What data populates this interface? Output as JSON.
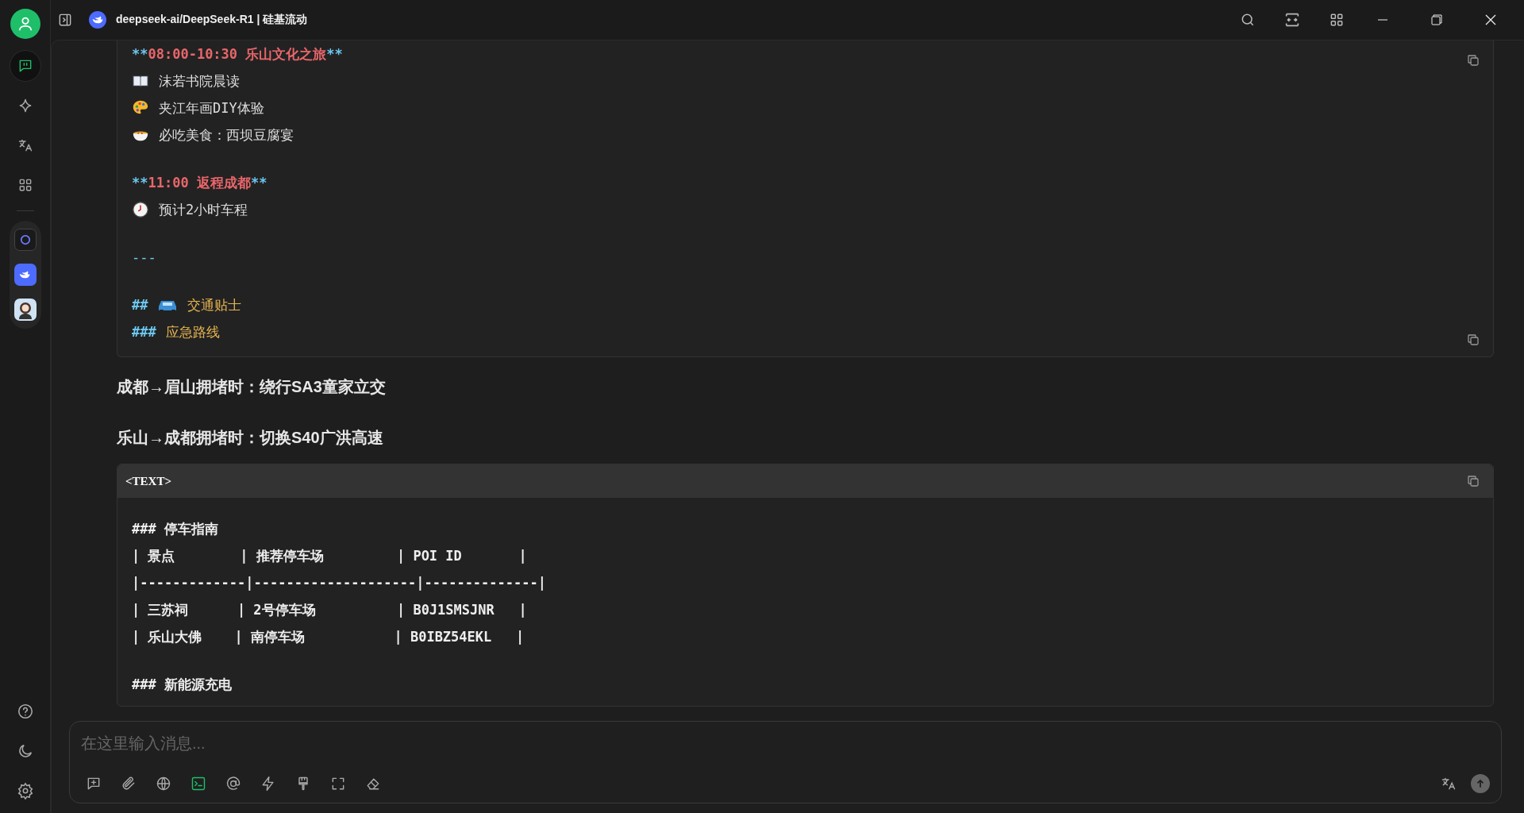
{
  "window": {
    "title": "deepseek-ai/DeepSeek-R1 | 硅基流动"
  },
  "sidebar": {
    "nav": [
      {
        "selected": true
      },
      {
        "selected": false
      },
      {
        "selected": false
      },
      {
        "selected": false
      }
    ]
  },
  "code_block_1": {
    "lines": [
      {
        "kind": "bold",
        "marker": "**",
        "text": "08:00-10:30 乐山文化之旅",
        "end": "**"
      },
      {
        "kind": "item",
        "text": "沫若书院晨读"
      },
      {
        "kind": "item",
        "text": "夹江年画DIY体验"
      },
      {
        "kind": "item",
        "text": "必吃美食：西坝豆腐宴"
      },
      {
        "kind": "bold",
        "marker": "**",
        "text": "11:00 返程成都",
        "end": "**"
      },
      {
        "kind": "item",
        "text": "预计2小时车程"
      },
      {
        "kind": "rule",
        "text": "---"
      },
      {
        "kind": "heading",
        "marker": "##",
        "text": "交通贴士"
      },
      {
        "kind": "heading",
        "marker": "###",
        "text": "应急路线"
      }
    ]
  },
  "paragraphs": [
    "成都→眉山拥堵时：绕行SA3童家立交",
    "乐山→成都拥堵时：切换S40广洪高速"
  ],
  "code_block_2": {
    "language": "<TEXT>",
    "lines": [
      {
        "kind": "heading",
        "text": "### 停车指南"
      },
      {
        "kind": "table",
        "text": "| 景点        | 推荐停车场         | POI ID       |"
      },
      {
        "kind": "table",
        "text": "|-------------|--------------------|--------------|"
      },
      {
        "kind": "table",
        "text": "| 三苏祠      | 2号停车场          | B0J1SMSJNR   |"
      },
      {
        "kind": "table",
        "text": "| 乐山大佛    | 南停车场           | B0IBZ54EKL   |"
      },
      {
        "kind": "heading",
        "text": "### 新能源充电"
      }
    ]
  },
  "composer": {
    "placeholder": "在这里输入消息...",
    "tools": [
      {
        "on": false
      },
      {
        "on": false
      },
      {
        "on": false
      },
      {
        "on": true
      },
      {
        "on": false
      },
      {
        "on": false
      },
      {
        "on": false
      },
      {
        "on": false
      },
      {
        "on": false
      }
    ]
  }
}
